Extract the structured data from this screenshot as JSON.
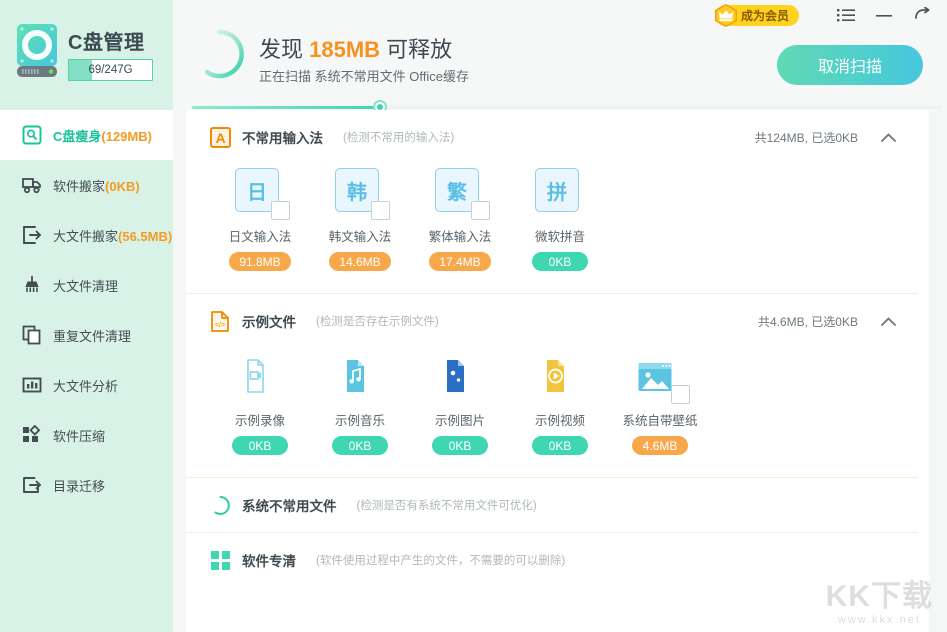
{
  "app": {
    "brand_title": "C盘管理",
    "capacity_text": "69/247G",
    "capacity_percent": 28
  },
  "titlebar": {
    "vip_label": "成为会员",
    "crown_icon": "crown-icon",
    "menu_icon": "menu-list-icon",
    "minimize_icon": "minimize-icon",
    "restore_icon": "restore-back-icon"
  },
  "sidebar": {
    "items": [
      {
        "label": "C盘瘦身",
        "size": "(129MB)",
        "icon": "disk-scan-icon",
        "active": true
      },
      {
        "label": "软件搬家",
        "size": "(0KB)",
        "icon": "truck-move-icon",
        "active": false
      },
      {
        "label": "大文件搬家",
        "size": "(56.5MB)",
        "icon": "file-export-icon",
        "active": false
      },
      {
        "label": "大文件清理",
        "size": "",
        "icon": "broom-clean-icon",
        "active": false
      },
      {
        "label": "重复文件清理",
        "size": "",
        "icon": "copy-files-icon",
        "active": false
      },
      {
        "label": "大文件分析",
        "size": "",
        "icon": "bar-chart-icon",
        "active": false
      },
      {
        "label": "软件压缩",
        "size": "",
        "icon": "grid-squares-icon",
        "active": false
      },
      {
        "label": "目录迁移",
        "size": "",
        "icon": "folder-export-icon",
        "active": false
      }
    ]
  },
  "scan": {
    "ring_icon": "loading-spinner-icon",
    "title_prefix": "发现 ",
    "title_amount": "185MB",
    "title_suffix": " 可释放",
    "subtitle": "正在扫描 系统不常用文件 Office缓存",
    "cancel_label": "取消扫描",
    "progress_percent": 25
  },
  "sections": [
    {
      "icon": "letter-a-icon",
      "title": "不常用输入法",
      "desc": "(检测不常用的输入法)",
      "meta": "共124MB, 已选0KB",
      "caret": "chevron-up-icon",
      "tiles": [
        {
          "glyph": "日",
          "label": "日文输入法",
          "badge": "91.8MB",
          "badge_color": "orange",
          "checkbox": true,
          "art": "square-letter"
        },
        {
          "glyph": "韩",
          "label": "韩文输入法",
          "badge": "14.6MB",
          "badge_color": "orange",
          "checkbox": true,
          "art": "square-letter"
        },
        {
          "glyph": "繁",
          "label": "繁体输入法",
          "badge": "17.4MB",
          "badge_color": "orange",
          "checkbox": true,
          "art": "square-letter"
        },
        {
          "glyph": "拼",
          "label": "微软拼音",
          "badge": "0KB",
          "badge_color": "green",
          "checkbox": false,
          "art": "square-letter"
        }
      ]
    },
    {
      "icon": "code-file-icon",
      "title": "示例文件",
      "desc": "(检测是否存在示例文件)",
      "meta": "共4.6MB, 已选0KB",
      "caret": "chevron-up-icon",
      "tiles": [
        {
          "label": "示例录像",
          "badge": "0KB",
          "badge_color": "green",
          "checkbox": false,
          "art": "file-camera",
          "art_color": "#8ed6ea"
        },
        {
          "label": "示例音乐",
          "badge": "0KB",
          "badge_color": "green",
          "checkbox": false,
          "art": "file-music",
          "art_color": "#5bc4e0"
        },
        {
          "label": "示例图片",
          "badge": "0KB",
          "badge_color": "green",
          "checkbox": false,
          "art": "file-picture",
          "art_color": "#2b6fc4"
        },
        {
          "label": "示例视频",
          "badge": "0KB",
          "badge_color": "green",
          "checkbox": false,
          "art": "file-video",
          "art_color": "#f2c33f"
        },
        {
          "label": "系统自带壁纸",
          "badge": "4.6MB",
          "badge_color": "orange",
          "checkbox": true,
          "art": "wallpaper",
          "art_color": "#5bc4e0"
        }
      ]
    },
    {
      "icon": "loading-circle-icon",
      "title": "系统不常用文件",
      "desc": "(检测是否有系统不常用文件可优化)",
      "meta": "",
      "caret": "",
      "tiles": []
    },
    {
      "icon": "grid-green-icon",
      "title": "软件专清",
      "desc": "(软件使用过程中产生的文件，不需要的可以删除)",
      "meta": "",
      "caret": "",
      "tiles": []
    }
  ],
  "watermark": {
    "main": "KK下载",
    "sub": "www.kkx.net"
  },
  "colors": {
    "brand_green": "#3fd6b2",
    "sidebar_bg": "#d9f2e8",
    "accent_orange": "#f7921e",
    "badge_orange": "#f7a84a",
    "badge_green": "#3fd6b2",
    "tile_blue": "#5cc0e5",
    "vip_yellow": "#ffd21e"
  }
}
